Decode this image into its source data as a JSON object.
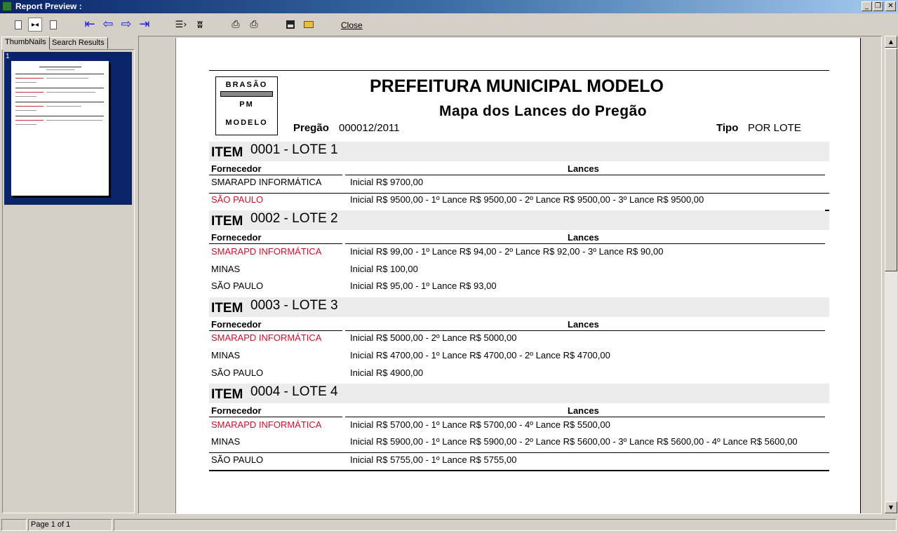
{
  "window": {
    "title": "Report Preview :"
  },
  "toolbar": {
    "close_label": "Close"
  },
  "tabs": [
    {
      "label": "ThumbNails"
    },
    {
      "label": "Search Results"
    }
  ],
  "thumbnails": [
    {
      "number": "1"
    }
  ],
  "statusbar": {
    "page_label": "Page 1 of 1"
  },
  "report": {
    "logo_lines": [
      "BRASÃO",
      "PM",
      "MODELO"
    ],
    "title": "PREFEITURA MUNICIPAL MODELO",
    "subtitle": "Mapa dos Lances do Pregão",
    "pregao_label": "Pregão",
    "pregao_value": "000012/2011",
    "tipo_label": "Tipo",
    "tipo_value": "POR LOTE",
    "item_label": "ITEM",
    "col_fornecedor": "Fornecedor",
    "col_lances": "Lances",
    "items": [
      {
        "title": "0001 - LOTE 1",
        "rows": [
          {
            "supplier": "SMARAPD INFORMÁTICA",
            "bids": "Inicial R$ 9700,00",
            "winner": false
          },
          {
            "supplier": "SÃO PAULO",
            "bids": "Inicial R$ 9500,00  - 1º Lance R$ 9500,00  - 2º Lance R$ 9500,00  - 3º Lance R$ 9500,00",
            "winner": true
          }
        ]
      },
      {
        "title": "0002 - LOTE 2",
        "rows": [
          {
            "supplier": "SMARAPD INFORMÁTICA",
            "bids": "Inicial R$ 99,00  - 1º Lance R$ 94,00  - 2º Lance R$ 92,00  - 3º Lance R$ 90,00",
            "winner": true
          },
          {
            "supplier": "MINAS",
            "bids": "Inicial R$ 100,00",
            "winner": false
          },
          {
            "supplier": "SÃO PAULO",
            "bids": "Inicial R$ 95,00  - 1º Lance R$ 93,00",
            "winner": false
          }
        ]
      },
      {
        "title": "0003 - LOTE 3",
        "rows": [
          {
            "supplier": "SMARAPD INFORMÁTICA",
            "bids": "Inicial R$ 5000,00  - 2º Lance R$ 5000,00",
            "winner": true
          },
          {
            "supplier": "MINAS",
            "bids": "Inicial R$ 4700,00  - 1º Lance R$ 4700,00  - 2º Lance R$ 4700,00",
            "winner": false
          },
          {
            "supplier": "SÃO PAULO",
            "bids": "Inicial R$ 4900,00",
            "winner": false
          }
        ]
      },
      {
        "title": "0004 - LOTE 4",
        "rows": [
          {
            "supplier": "SMARAPD INFORMÁTICA",
            "bids": "Inicial R$ 5700,00  - 1º Lance R$ 5700,00  - 4º Lance R$ 5500,00",
            "winner": true
          },
          {
            "supplier": "MINAS",
            "bids": "Inicial R$ 5900,00  - 1º Lance R$ 5900,00  - 2º Lance R$ 5600,00  - 3º Lance R$ 5600,00  - 4º Lance R$ 5600,00",
            "winner": false
          },
          {
            "supplier": "SÃO PAULO",
            "bids": "Inicial R$ 5755,00  - 1º Lance R$ 5755,00",
            "winner": false
          }
        ]
      }
    ]
  },
  "colors": {
    "winner": "#c8102e",
    "titlebar": "#0a246a",
    "arrows": "#1f1fe0"
  }
}
